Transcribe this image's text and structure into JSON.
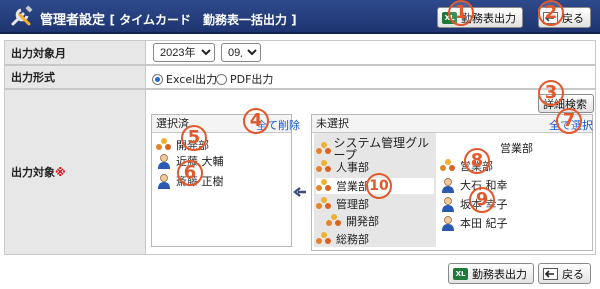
{
  "header": {
    "title": "管理者設定",
    "subtitle": "[ タイムカード　勤務表一括出力 ]",
    "export_button": "勤務表出力",
    "back_button": "戻る",
    "export_icon": "XL"
  },
  "form": {
    "month_label": "出力対象月",
    "year_value": "2023年",
    "month_value": "09月",
    "format_label": "出力形式",
    "format_excel": "Excel出力",
    "format_pdf": "PDF出力",
    "target_label": "出力対象",
    "required_mark": "※",
    "detail_search": "詳細検索"
  },
  "selected_panel": {
    "title": "選択済",
    "delete_all": "全て削除",
    "items": [
      {
        "label": "開発部",
        "icon": "group-icon"
      },
      {
        "label": "近藤 大輔",
        "icon": "person-icon"
      },
      {
        "label": "斎藤 正樹",
        "icon": "person-icon"
      }
    ]
  },
  "unselected_panel": {
    "title": "未選択",
    "select_all": "全て選択",
    "groups": [
      {
        "label": "システム管理グループ"
      },
      {
        "label": "人事部"
      },
      {
        "label": "営業部"
      },
      {
        "label": "管理部"
      },
      {
        "label": "開発部"
      },
      {
        "label": "総務部"
      }
    ],
    "right_header": "営業部",
    "right_items": [
      {
        "label": "営業部",
        "icon": "group-icon"
      },
      {
        "label": "大石 和幸",
        "icon": "person-icon"
      },
      {
        "label": "坂本 幸子",
        "icon": "person-icon"
      },
      {
        "label": "本田 紀子",
        "icon": "person-icon"
      }
    ]
  },
  "footer": {
    "export_button": "勤務表出力",
    "back_button": "戻る"
  },
  "badges": [
    "1",
    "2",
    "3",
    "4",
    "5",
    "6",
    "7",
    "8",
    "9",
    "10"
  ],
  "colors": {
    "header": "#1d3470",
    "badge": "#e2582c",
    "link": "#1155cc"
  }
}
